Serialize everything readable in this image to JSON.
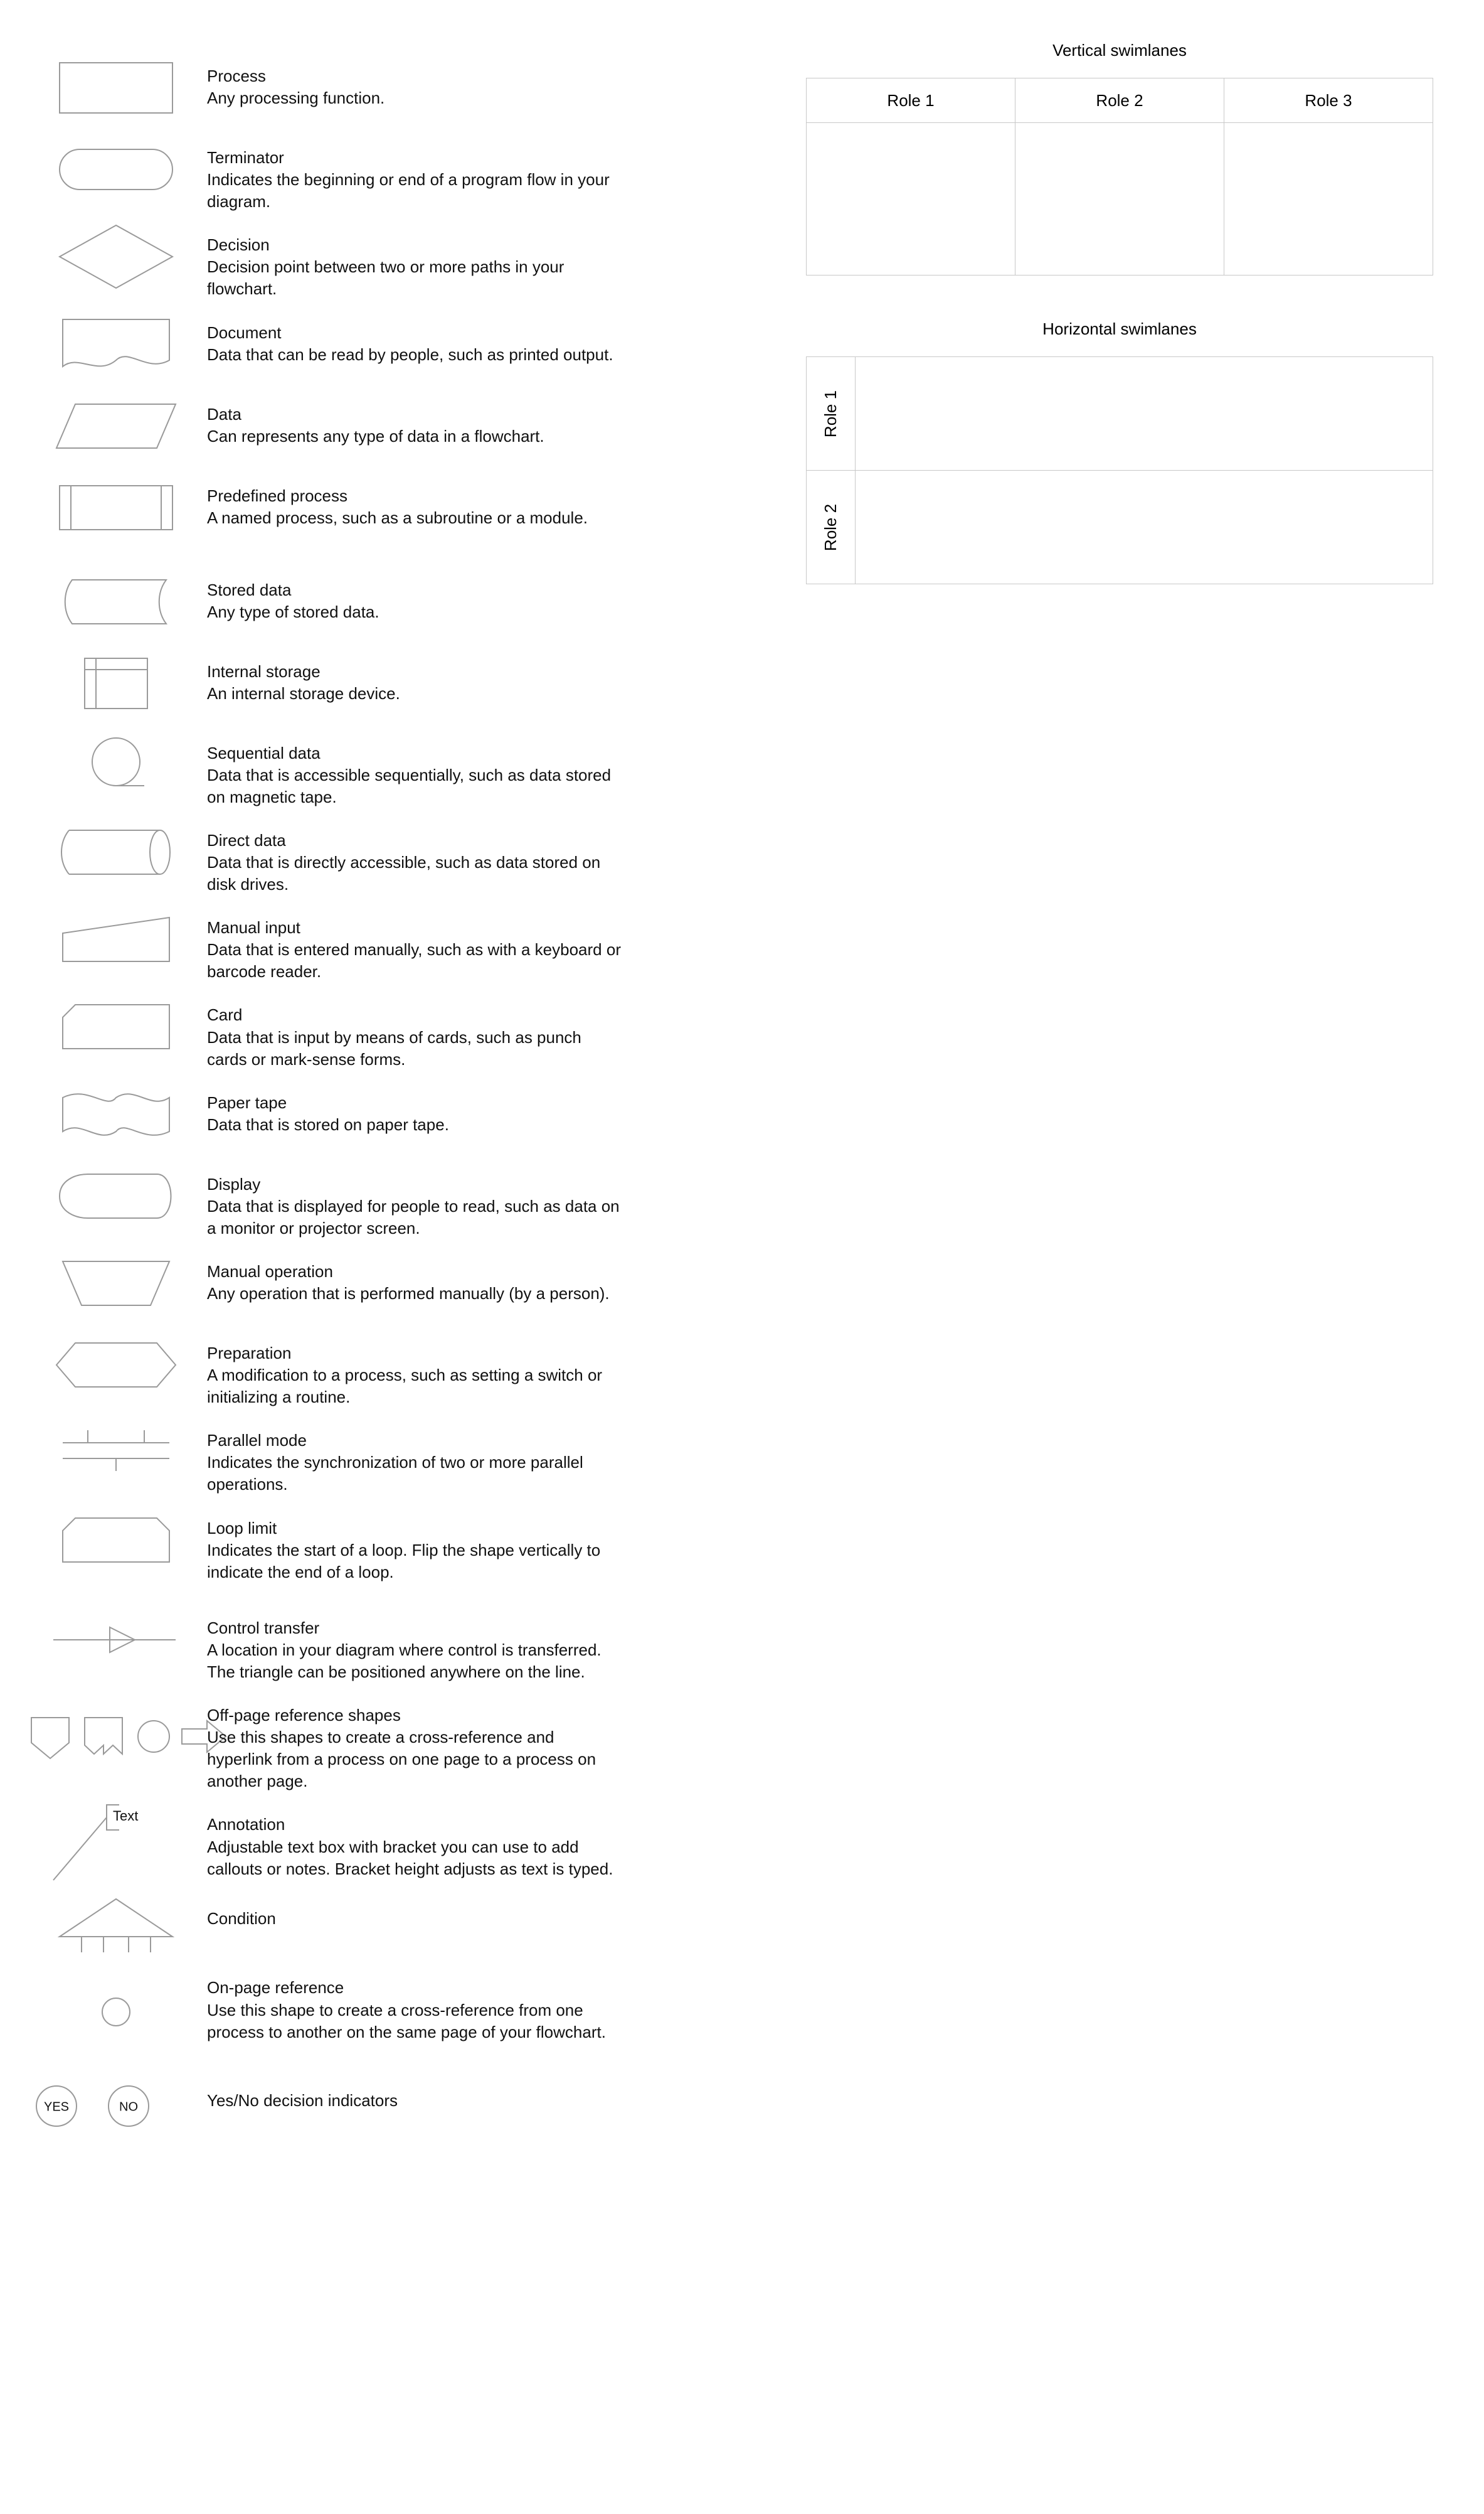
{
  "symbols": [
    {
      "name": "Process",
      "desc": "Any processing function."
    },
    {
      "name": "Terminator",
      "desc": "Indicates the beginning or end of a program flow in your diagram."
    },
    {
      "name": "Decision",
      "desc": "Decision point between two or more paths in your flowchart."
    },
    {
      "name": "Document",
      "desc": "Data that can be read by people, such as printed output."
    },
    {
      "name": "Data",
      "desc": "Can represents any type of data in a flowchart."
    },
    {
      "name": "Predefined process",
      "desc": "A named process, such as a subroutine or a module."
    },
    {
      "name": "Stored data",
      "desc": "Any type of stored data."
    },
    {
      "name": "Internal storage",
      "desc": "An internal storage device."
    },
    {
      "name": "Sequential data",
      "desc": "Data that is accessible sequentially, such as data stored on magnetic tape."
    },
    {
      "name": "Direct data",
      "desc": "Data that is directly accessible, such as data stored on disk drives."
    },
    {
      "name": "Manual input",
      "desc": "Data that is entered manually, such as with a keyboard or barcode reader."
    },
    {
      "name": "Card",
      "desc": "Data that is input by means of cards, such as punch cards or mark-sense forms."
    },
    {
      "name": "Paper tape",
      "desc": "Data that is stored on paper tape."
    },
    {
      "name": "Display",
      "desc": "Data that is displayed for people to read, such as data on a monitor or projector screen."
    },
    {
      "name": "Manual operation",
      "desc": "Any operation that is performed manually (by a person)."
    },
    {
      "name": "Preparation",
      "desc": "A modification to a process, such as setting a switch or initializing a routine."
    },
    {
      "name": "Parallel mode",
      "desc": "Indicates the synchronization of two or more parallel operations."
    },
    {
      "name": "Loop limit",
      "desc": "Indicates the start of a loop. Flip the shape vertically to indicate the end of a loop."
    },
    {
      "name": "Control transfer",
      "desc": "A location in your diagram where control is transferred. The triangle can be positioned anywhere on the line."
    },
    {
      "name": "Off-page reference shapes",
      "desc": "Use this shapes to create a cross-reference and hyperlink from a process on one page to a process on another page."
    },
    {
      "name": "Annotation",
      "desc": "Adjustable text box with bracket you can use to add callouts or notes. Bracket height adjusts as text is typed."
    },
    {
      "name": "Condition",
      "desc": ""
    },
    {
      "name": "On-page reference",
      "desc": "Use this shape to create a cross-reference from one process to another on the same page of your flowchart."
    },
    {
      "name": "Yes/No decision indicators",
      "desc": ""
    }
  ],
  "annotation_label": "Text",
  "decision_yes": "YES",
  "decision_no": "NO",
  "swimlanes": {
    "vertical": {
      "title": "Vertical swimlanes",
      "roles": [
        "Role 1",
        "Role 2",
        "Role 3"
      ]
    },
    "horizontal": {
      "title": "Horizontal swimlanes",
      "roles": [
        "Role 1",
        "Role 2"
      ]
    }
  }
}
